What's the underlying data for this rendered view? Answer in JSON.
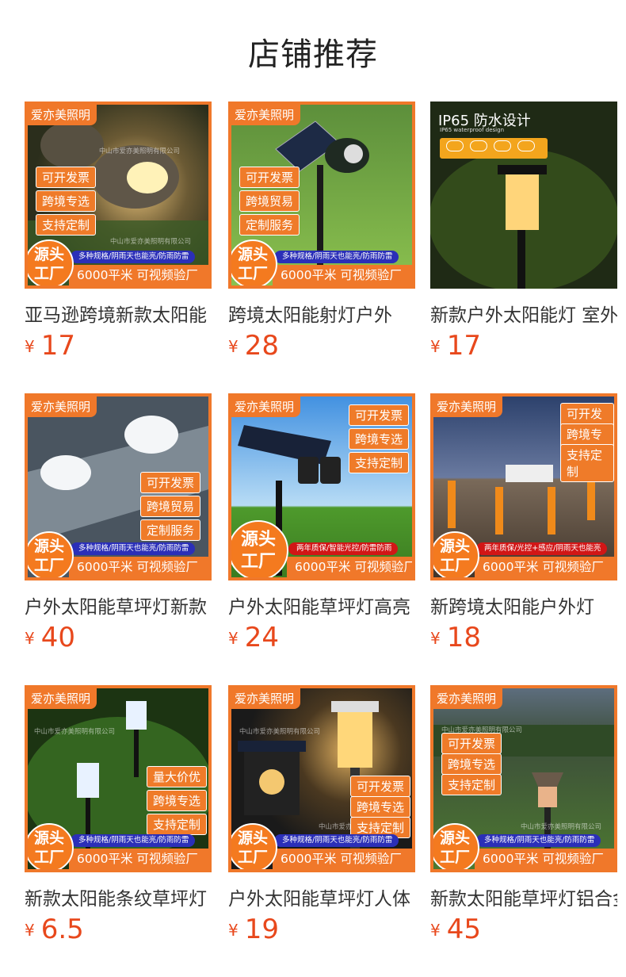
{
  "section": {
    "title": "店铺推荐"
  },
  "currency": "¥",
  "products": [
    {
      "name": "亚马逊跨境新款太阳能",
      "price": "17",
      "brand": "爱亦美照明",
      "pills": [
        "可开发票",
        "跨境专选",
        "支持定制"
      ],
      "features": "多种规格/阴雨天也能亮/防雨防雷",
      "area": "6000平米 可视频验厂",
      "source": "源头工厂",
      "watermark": "中山市爱亦美照明有限公司"
    },
    {
      "name": "跨境太阳能射灯户外",
      "price": "28",
      "brand": "爱亦美照明",
      "pills": [
        "可开发票",
        "跨境贸易",
        "定制服务"
      ],
      "features": "多种规格/阴雨天也能亮/防雨防雷",
      "area": "6000平米 可视频验厂",
      "source": "源头工厂"
    },
    {
      "name": "新款户外太阳能灯 室外",
      "price": "17",
      "ip_title": "IP65  防水设计",
      "ip_sub": "IP65 waterproof design"
    },
    {
      "name": "户外太阳能草坪灯新款",
      "price": "40",
      "brand": "爱亦美照明",
      "pills": [
        "可开发票",
        "跨境贸易",
        "定制服务"
      ],
      "features": "多种规格/阴雨天也能亮/防雨防雷",
      "area": "6000平米 可视频验厂",
      "source": "源头工厂"
    },
    {
      "name": "户外太阳能草坪灯高亮",
      "price": "24",
      "brand": "爱亦美照明",
      "pills": [
        "可开发票",
        "跨境专选",
        "支持定制"
      ],
      "features": "两年质保/智能光控/防雷防雨",
      "area": "6000平米 可视频验厂",
      "source": "源头工厂"
    },
    {
      "name": "新跨境太阳能户外灯",
      "price": "18",
      "brand": "爱亦美照明",
      "pills": [
        "可开发票",
        "跨境专选",
        "支持定制"
      ],
      "features": "两年质保/光控+感应/阴雨天也能亮",
      "area": "6000平米 可视频验厂",
      "source": "源头工厂"
    },
    {
      "name": "新款太阳能条纹草坪灯",
      "price": "6.5",
      "brand": "爱亦美照明",
      "pills": [
        "量大价优",
        "跨境专选",
        "支持定制"
      ],
      "features": "多种规格/阴雨天也能亮/防雨防雷",
      "area": "6000平米 可视频验厂",
      "source": "源头工厂",
      "watermark": "中山市爱亦美照明有限公司"
    },
    {
      "name": "户外太阳能草坪灯人体",
      "price": "19",
      "brand": "爱亦美照明",
      "pills": [
        "可开发票",
        "跨境专选",
        "支持定制"
      ],
      "features": "多种规格/阴雨天也能亮/防雨防雷",
      "area": "6000平米 可视频验厂",
      "source": "源头工厂",
      "watermark": "中山市爱亦美照明有限公司"
    },
    {
      "name": "新款太阳能草坪灯铝合金",
      "price": "45",
      "brand": "爱亦美照明",
      "pills": [
        "可开发票",
        "跨境专选",
        "支持定制"
      ],
      "features": "多种规格/阴雨天也能亮/防雨防雷",
      "area": "6000平米 可视频验厂",
      "source": "源头工厂",
      "watermark": "中山市爱亦美照明有限公司"
    }
  ]
}
